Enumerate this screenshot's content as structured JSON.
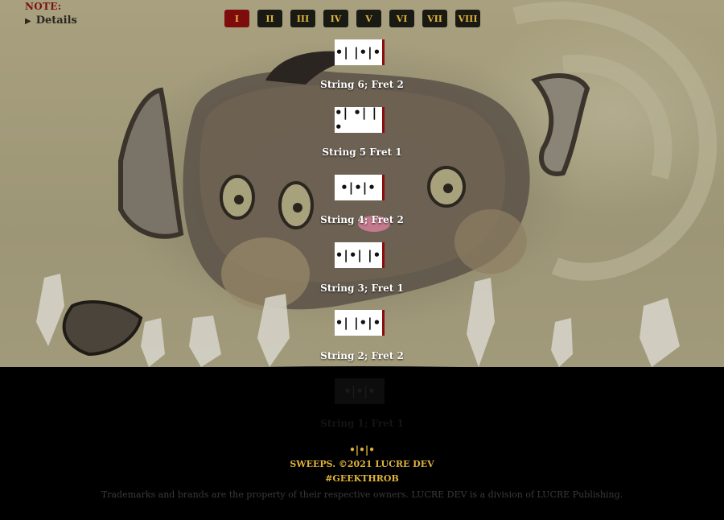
{
  "note": {
    "label": "NOTE:",
    "details": "Details"
  },
  "tabs": [
    "I",
    "II",
    "III",
    "IV",
    "V",
    "VI",
    "VII",
    "VIII"
  ],
  "active_tab": "I",
  "steps": [
    {
      "glyph": "•| |•|•",
      "label": "String 6; Fret 2"
    },
    {
      "glyph": "•| •| |•",
      "label": "String 5 Fret 1"
    },
    {
      "glyph": "•|•|•",
      "label": "String 4; Fret 2"
    },
    {
      "glyph": "•|•| |•",
      "label": "String 3; Fret 1"
    },
    {
      "glyph": "•| |•|•",
      "label": "String 2; Fret 2"
    },
    {
      "glyph": "•|•|•",
      "label": "String 1; Fret 1"
    }
  ],
  "footer": {
    "logo": "•|•|•",
    "copyright": "SWEEPS. ©2021 LUCRE DEV",
    "hashtag": "#GEEKTHROB",
    "trademark": "Trademarks and brands are the property of their respective owners. LUCRE DEV is a division of LUCRE Publishing."
  },
  "colors": {
    "accent": "#e0b43a",
    "active_tab": "#7e0c0c",
    "tab_bg": "#1a1a14",
    "note": "#7a1010",
    "footer_bg": "#000000"
  }
}
